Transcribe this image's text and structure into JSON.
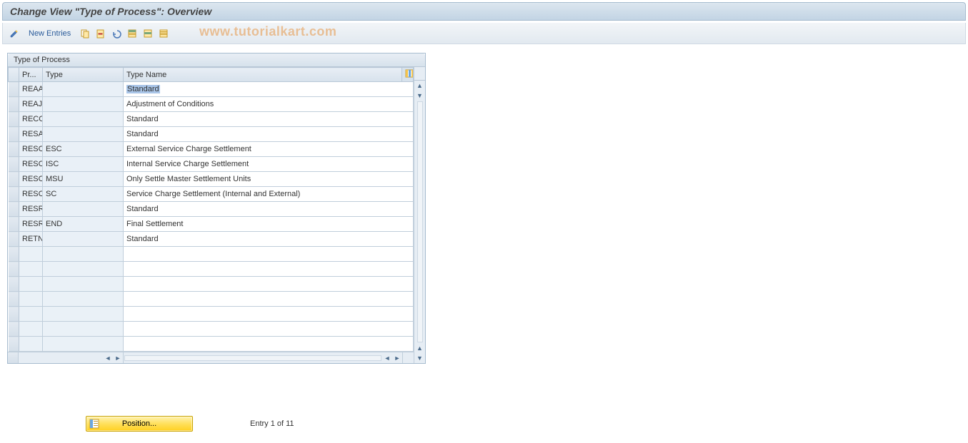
{
  "titlebar": {
    "text": "Change View \"Type of Process\": Overview"
  },
  "toolbar": {
    "new_entries_label": "New Entries"
  },
  "watermark": "www.tutorialkart.com",
  "panel": {
    "title": "Type of Process"
  },
  "columns": {
    "pr": "Pr...",
    "type": "Type",
    "name": "Type Name"
  },
  "rows": [
    {
      "pr": "REAA",
      "type": "",
      "name": "Standard",
      "selected_text": true
    },
    {
      "pr": "REAJ",
      "type": "",
      "name": "Adjustment of Conditions"
    },
    {
      "pr": "RECO",
      "type": "",
      "name": "Standard"
    },
    {
      "pr": "RESA",
      "type": "",
      "name": "Standard"
    },
    {
      "pr": "RESC",
      "type": "ESC",
      "name": "External Service Charge Settlement"
    },
    {
      "pr": "RESC",
      "type": "ISC",
      "name": "Internal Service Charge Settlement"
    },
    {
      "pr": "RESC",
      "type": "MSU",
      "name": "Only Settle Master Settlement Units"
    },
    {
      "pr": "RESC",
      "type": "SC",
      "name": "Service Charge Settlement (Internal and External)"
    },
    {
      "pr": "RESR",
      "type": "",
      "name": "Standard"
    },
    {
      "pr": "RESR",
      "type": "END",
      "name": "Final Settlement"
    },
    {
      "pr": "RETN",
      "type": "",
      "name": "Standard"
    }
  ],
  "empty_rows": 7,
  "footer": {
    "position_label": "Position...",
    "entry_text": "Entry 1 of 11"
  }
}
